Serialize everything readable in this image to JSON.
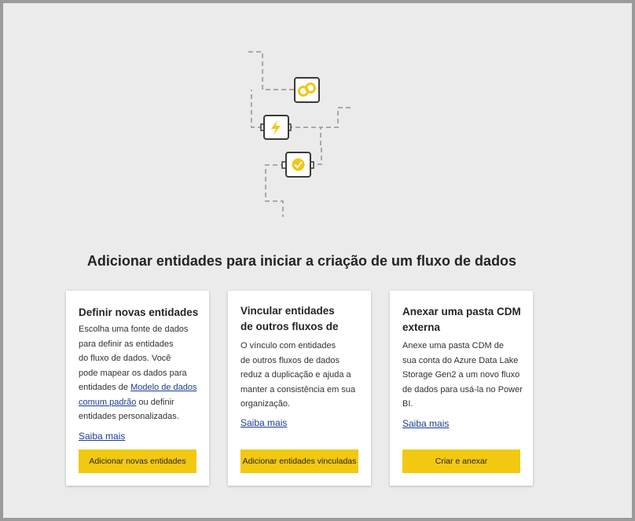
{
  "heading": "Adicionar entidades para iniciar a criação de um fluxo de dados",
  "illustration": {
    "icons": [
      "link-icon",
      "lightning-icon",
      "check-badge-icon"
    ],
    "accent_color": "#f2c811",
    "line_color": "#a8a8a8"
  },
  "cards": [
    {
      "title": "Definir novas entidades",
      "description_lines": [
        "Escolha uma fonte de dados",
        "para definir as entidades",
        "do fluxo de dados. Você",
        "pode mapear os dados para"
      ],
      "description_prefix": "entidades de ",
      "description_link_line1": "Modelo de dados",
      "description_link_line2": "comum padrão",
      "description_suffix": " ou definir",
      "description_last": "entidades personalizadas.",
      "learn_more": "Saiba mais",
      "button": "Adicionar novas entidades"
    },
    {
      "title_line1": "Vincular entidades",
      "title_line2": "de outros fluxos de",
      "description_lines": [
        "O vínculo com entidades",
        "de outros fluxos de dados",
        "reduz a duplicação e ajuda a",
        "manter a consistência em sua",
        "organização."
      ],
      "learn_more": "Saiba mais",
      "button": "Adicionar entidades vinculadas"
    },
    {
      "title_line1": "Anexar uma pasta CDM",
      "title_line2": "externa",
      "description_lines": [
        "Anexe uma pasta CDM de",
        "sua conta do Azure Data Lake",
        "Storage Gen2 a um novo fluxo",
        "de dados para usá-la no Power",
        "BI."
      ],
      "learn_more": "Saiba mais",
      "button": "Criar e anexar"
    }
  ]
}
